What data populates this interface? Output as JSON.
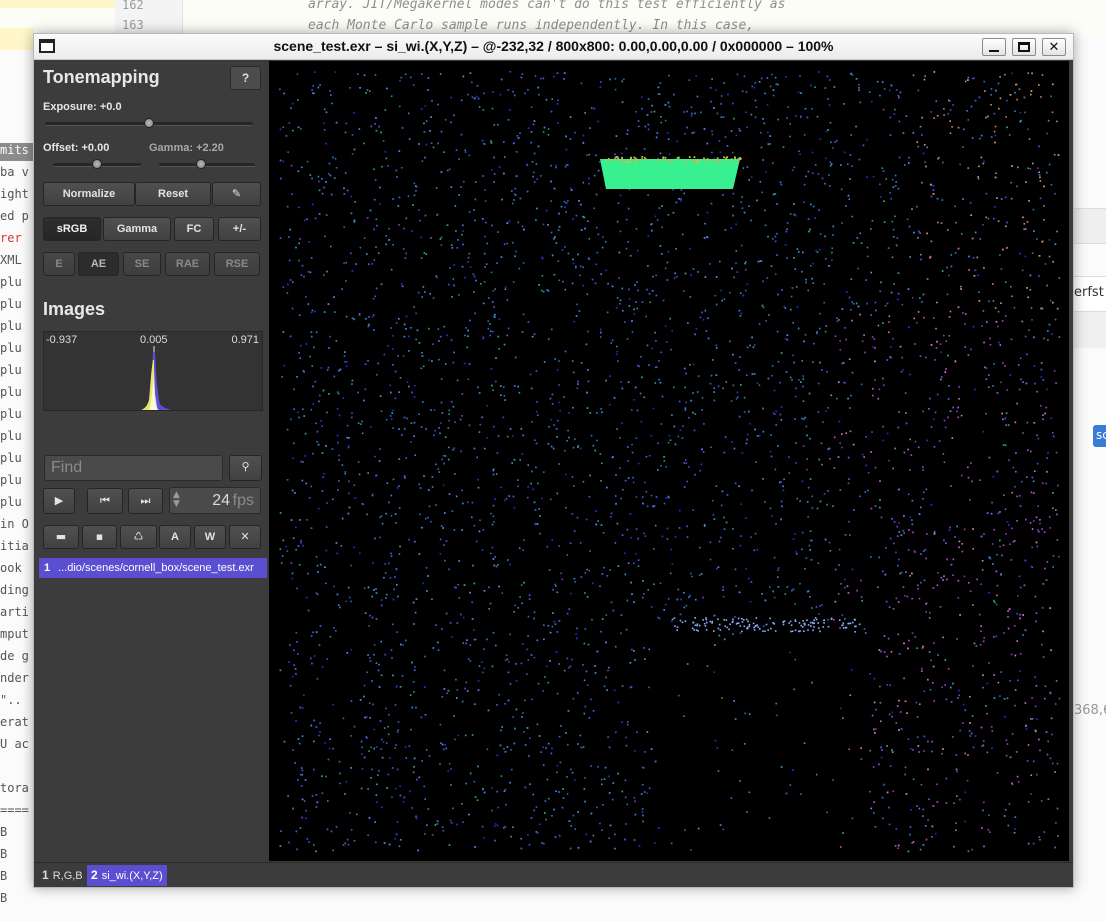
{
  "background_editor": {
    "line_numbers": [
      "162",
      "163"
    ],
    "code_lines": [
      "array. JIT/Megakernel modes can't do this test efficiently as",
      "each Monte Carlo sample runs independently. In this case,"
    ],
    "left_fragments": [
      "mits",
      "ba v",
      "ight",
      "ed p",
      "rer",
      "XML",
      " plu",
      " plu",
      " plu",
      " plu",
      " plu",
      " plu",
      " plu",
      " plu",
      " plu",
      " plu",
      " plu",
      "in O",
      "itia",
      "ook",
      "ding",
      "arti",
      "mput",
      "de g",
      "nder",
      " \"..",
      "erat",
      "U ac",
      "",
      "tora",
      "====",
      " B",
      " B",
      " B",
      " B"
    ],
    "right_fragments": {
      "perf": "erfst",
      "button": "sc",
      "coords": "368,6"
    }
  },
  "window": {
    "title": "scene_test.exr – si_wi.(X,Y,Z) – @-232,32 / 800x800: 0.00,0.00,0.00 / 0x000000 – 100%",
    "icons": {
      "app": "window-icon",
      "minimize": "minimize-icon",
      "maximize": "maximize-icon",
      "close": "close-icon"
    }
  },
  "tonemapping": {
    "title": "Tonemapping",
    "help_label": "?",
    "exposure_label": "Exposure: +0.0",
    "exposure_value": 0.5,
    "offset_label": "Offset: +0.00",
    "offset_value": 0.5,
    "gamma_label": "Gamma: +2.20",
    "gamma_value": 0.44,
    "buttons": {
      "normalize": "Normalize",
      "reset": "Reset",
      "pen": "✎"
    },
    "modes": [
      "sRGB",
      "Gamma",
      "FC",
      "+/-"
    ],
    "active_mode": "sRGB",
    "metrics": [
      "E",
      "AE",
      "SE",
      "RAE",
      "RSE"
    ],
    "active_metric": "AE"
  },
  "images": {
    "title": "Images",
    "histogram": {
      "min_label": "-0.937",
      "mid_label": "0.005",
      "max_label": "0.971"
    },
    "find_placeholder": "Find",
    "fps_value": "24",
    "fps_unit": "fps",
    "playback_icons": [
      "play-icon",
      "skip-back-icon",
      "skip-forward-icon"
    ],
    "file_buttons": [
      {
        "name": "open-folder-icon",
        "glyph": "▬"
      },
      {
        "name": "save-icon",
        "glyph": "▪"
      },
      {
        "name": "reload-icon",
        "glyph": "♺"
      },
      {
        "name": "reload-all-button",
        "glyph": "A"
      },
      {
        "name": "watch-button",
        "glyph": "W"
      },
      {
        "name": "close-image-icon",
        "glyph": "✕"
      }
    ],
    "list": [
      {
        "index": "1",
        "path": "...dio/scenes/cornell_box/scene_test.exr"
      }
    ]
  },
  "channels": [
    {
      "index": "1",
      "name": "R,G,B",
      "active": false
    },
    {
      "index": "2",
      "name": "si_wi.(X,Y,Z)",
      "active": true
    }
  ],
  "colors": {
    "accent": "#5a4fd0",
    "panel": "#3c3c3c",
    "light_emitter": "#38f090"
  }
}
